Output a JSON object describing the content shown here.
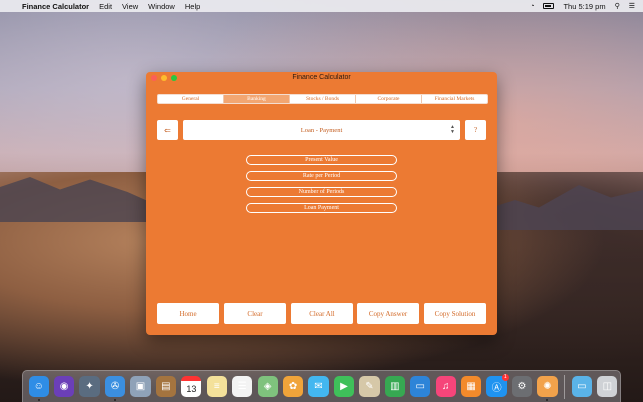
{
  "menubar": {
    "app_name": "Finance Calculator",
    "menus": [
      "Edit",
      "View",
      "Window",
      "Help"
    ],
    "clock": "Thu 5:19 pm"
  },
  "window": {
    "title": "Finance Calculator",
    "tabs": [
      {
        "label": "General",
        "active": false
      },
      {
        "label": "Banking",
        "active": true
      },
      {
        "label": "Stocks / Bonds",
        "active": false
      },
      {
        "label": "Corporate",
        "active": false
      },
      {
        "label": "Financial Markets",
        "active": false
      }
    ],
    "back_glyph": "⇐",
    "calculation_select": {
      "value": "Loan - Payment"
    },
    "help_label": "?",
    "fields": [
      "Present Value",
      "Rate per Period",
      "Number of Periods",
      "Loan Payment"
    ],
    "buttons": [
      "Home",
      "Clear",
      "Clear All",
      "Copy Answer",
      "Copy Solution"
    ]
  },
  "dock": {
    "calendar_day": "13",
    "mail_badge": "1",
    "apps": [
      {
        "name": "finder-icon",
        "glyph": "☺",
        "color": "#2f8de6",
        "running": true
      },
      {
        "name": "siri-icon",
        "glyph": "◉",
        "color": "#6b3fb8",
        "running": false
      },
      {
        "name": "launchpad-icon",
        "glyph": "✦",
        "color": "#5a6c80",
        "running": false
      },
      {
        "name": "safari-icon",
        "glyph": "✇",
        "color": "#3b8fe0",
        "running": true
      },
      {
        "name": "preview-icon",
        "glyph": "▣",
        "color": "#8fa2b8",
        "running": false
      },
      {
        "name": "notes-brown-icon",
        "glyph": "▤",
        "color": "#a4743f",
        "running": false
      },
      {
        "name": "calendar-icon",
        "glyph": "",
        "color": "#ffffff",
        "running": false
      },
      {
        "name": "notes-icon",
        "glyph": "≡",
        "color": "#f4e19a",
        "running": false
      },
      {
        "name": "reminders-icon",
        "glyph": "☰",
        "color": "#f3f3f3",
        "running": false
      },
      {
        "name": "maps-icon",
        "glyph": "◈",
        "color": "#7fc27d",
        "running": false
      },
      {
        "name": "photos-icon",
        "glyph": "✿",
        "color": "#f0a43a",
        "running": false
      },
      {
        "name": "messages-icon",
        "glyph": "✉",
        "color": "#43b7f0",
        "running": false
      },
      {
        "name": "facetime-icon",
        "glyph": "▶",
        "color": "#3fc05a",
        "running": false
      },
      {
        "name": "textedit-icon",
        "glyph": "✎",
        "color": "#d6c8a8",
        "running": false
      },
      {
        "name": "numbers-icon",
        "glyph": "▥",
        "color": "#37a852",
        "running": false
      },
      {
        "name": "keynote-icon",
        "glyph": "▭",
        "color": "#2d84d8",
        "running": false
      },
      {
        "name": "music-icon",
        "glyph": "♫",
        "color": "#f6457a",
        "running": false
      },
      {
        "name": "books-icon",
        "glyph": "▦",
        "color": "#f38a2b",
        "running": false
      },
      {
        "name": "app-store-icon",
        "glyph": "Ⓐ",
        "color": "#1f93f0",
        "running": false
      },
      {
        "name": "system-preferences-icon",
        "glyph": "⚙",
        "color": "#6c6e72",
        "running": false
      },
      {
        "name": "finance-calculator-icon",
        "glyph": "✺",
        "color": "#f2a24b",
        "running": true
      }
    ],
    "trailing": [
      {
        "name": "downloads-folder-icon",
        "glyph": "▭",
        "color": "#5ab3e8"
      },
      {
        "name": "trash-icon",
        "glyph": "◫",
        "color": "#cfd2d6"
      }
    ]
  }
}
